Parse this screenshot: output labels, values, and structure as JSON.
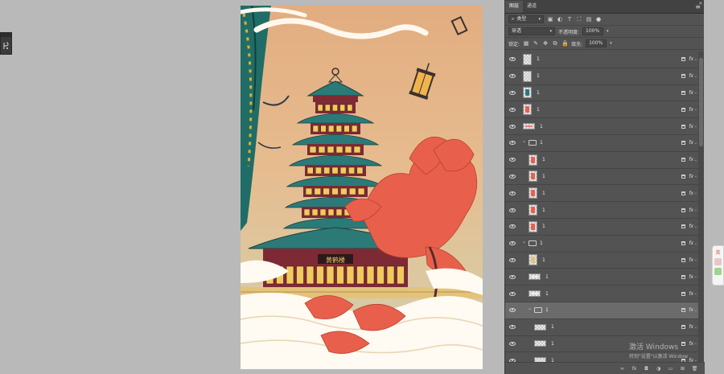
{
  "panel": {
    "tabs": [
      "图层",
      "通道"
    ],
    "menu_icon": "hamburger-icon",
    "filter": {
      "kind_label": "类型",
      "icons": [
        "image-filter-icon",
        "adjustment-filter-icon",
        "type-filter-icon",
        "shape-filter-icon",
        "smart-object-filter-icon"
      ]
    },
    "blend_mode": "穿透",
    "opacity_label": "不透明度:",
    "opacity_value": "100%",
    "lock_label": "锁定:",
    "fill_label": "填充:",
    "fill_value": "100%"
  },
  "layers": [
    {
      "name": "1",
      "kind": "layer",
      "indent": 0,
      "thumb": "blank"
    },
    {
      "name": "1",
      "kind": "layer",
      "indent": 0,
      "thumb": "blank"
    },
    {
      "name": "1",
      "kind": "layer",
      "indent": 0,
      "thumb": "teal-strip"
    },
    {
      "name": "1",
      "kind": "layer",
      "indent": 0,
      "thumb": "red-small"
    },
    {
      "name": "1",
      "kind": "layer",
      "indent": 0,
      "thumb": "pink-wide"
    },
    {
      "name": "1",
      "kind": "group",
      "indent": 0
    },
    {
      "name": "1",
      "kind": "layer",
      "indent": 1,
      "thumb": "red-flower"
    },
    {
      "name": "1",
      "kind": "layer",
      "indent": 1,
      "thumb": "red-flower"
    },
    {
      "name": "1",
      "kind": "layer",
      "indent": 1,
      "thumb": "red-flower"
    },
    {
      "name": "1",
      "kind": "layer",
      "indent": 1,
      "thumb": "red-small"
    },
    {
      "name": "1",
      "kind": "layer",
      "indent": 1,
      "thumb": "red-flower"
    },
    {
      "name": "1",
      "kind": "group",
      "indent": 0
    },
    {
      "name": "1",
      "kind": "layer",
      "indent": 1,
      "thumb": "yellow"
    },
    {
      "name": "1",
      "kind": "layer",
      "indent": 1,
      "thumb": "cloud"
    },
    {
      "name": "1",
      "kind": "layer",
      "indent": 1,
      "thumb": "cloud"
    },
    {
      "name": "1",
      "kind": "group",
      "indent": 1,
      "selected": true
    },
    {
      "name": "1",
      "kind": "layer",
      "indent": 2,
      "thumb": "line-teal"
    },
    {
      "name": "1",
      "kind": "layer",
      "indent": 2,
      "thumb": "line-red"
    },
    {
      "name": "1",
      "kind": "layer",
      "indent": 2,
      "thumb": "line-grey"
    },
    {
      "name": "1",
      "kind": "layer",
      "indent": 2,
      "thumb": "line-red"
    }
  ],
  "artwork": {
    "signboard": "黄鹤楼",
    "colors": {
      "sky": "#e4b88a",
      "roof": "#2b7a78",
      "wall": "#7e2a35",
      "flower": "#e8604c",
      "cloud": "#fffaf2"
    }
  },
  "footer_buttons": [
    "link-icon",
    "fx-icon",
    "mask-icon",
    "adjustment-icon",
    "folder-icon",
    "new-layer-icon",
    "trash-icon"
  ],
  "footer_labels": {
    "link": "∞",
    "fx": "fx",
    "mask": "◘",
    "adjust": "◑",
    "folder": "▭",
    "new": "⊞",
    "trash": "🗑"
  },
  "watermark": {
    "line1": "激活 Windows",
    "line2": "转到\"设置\"以激活 Window"
  }
}
